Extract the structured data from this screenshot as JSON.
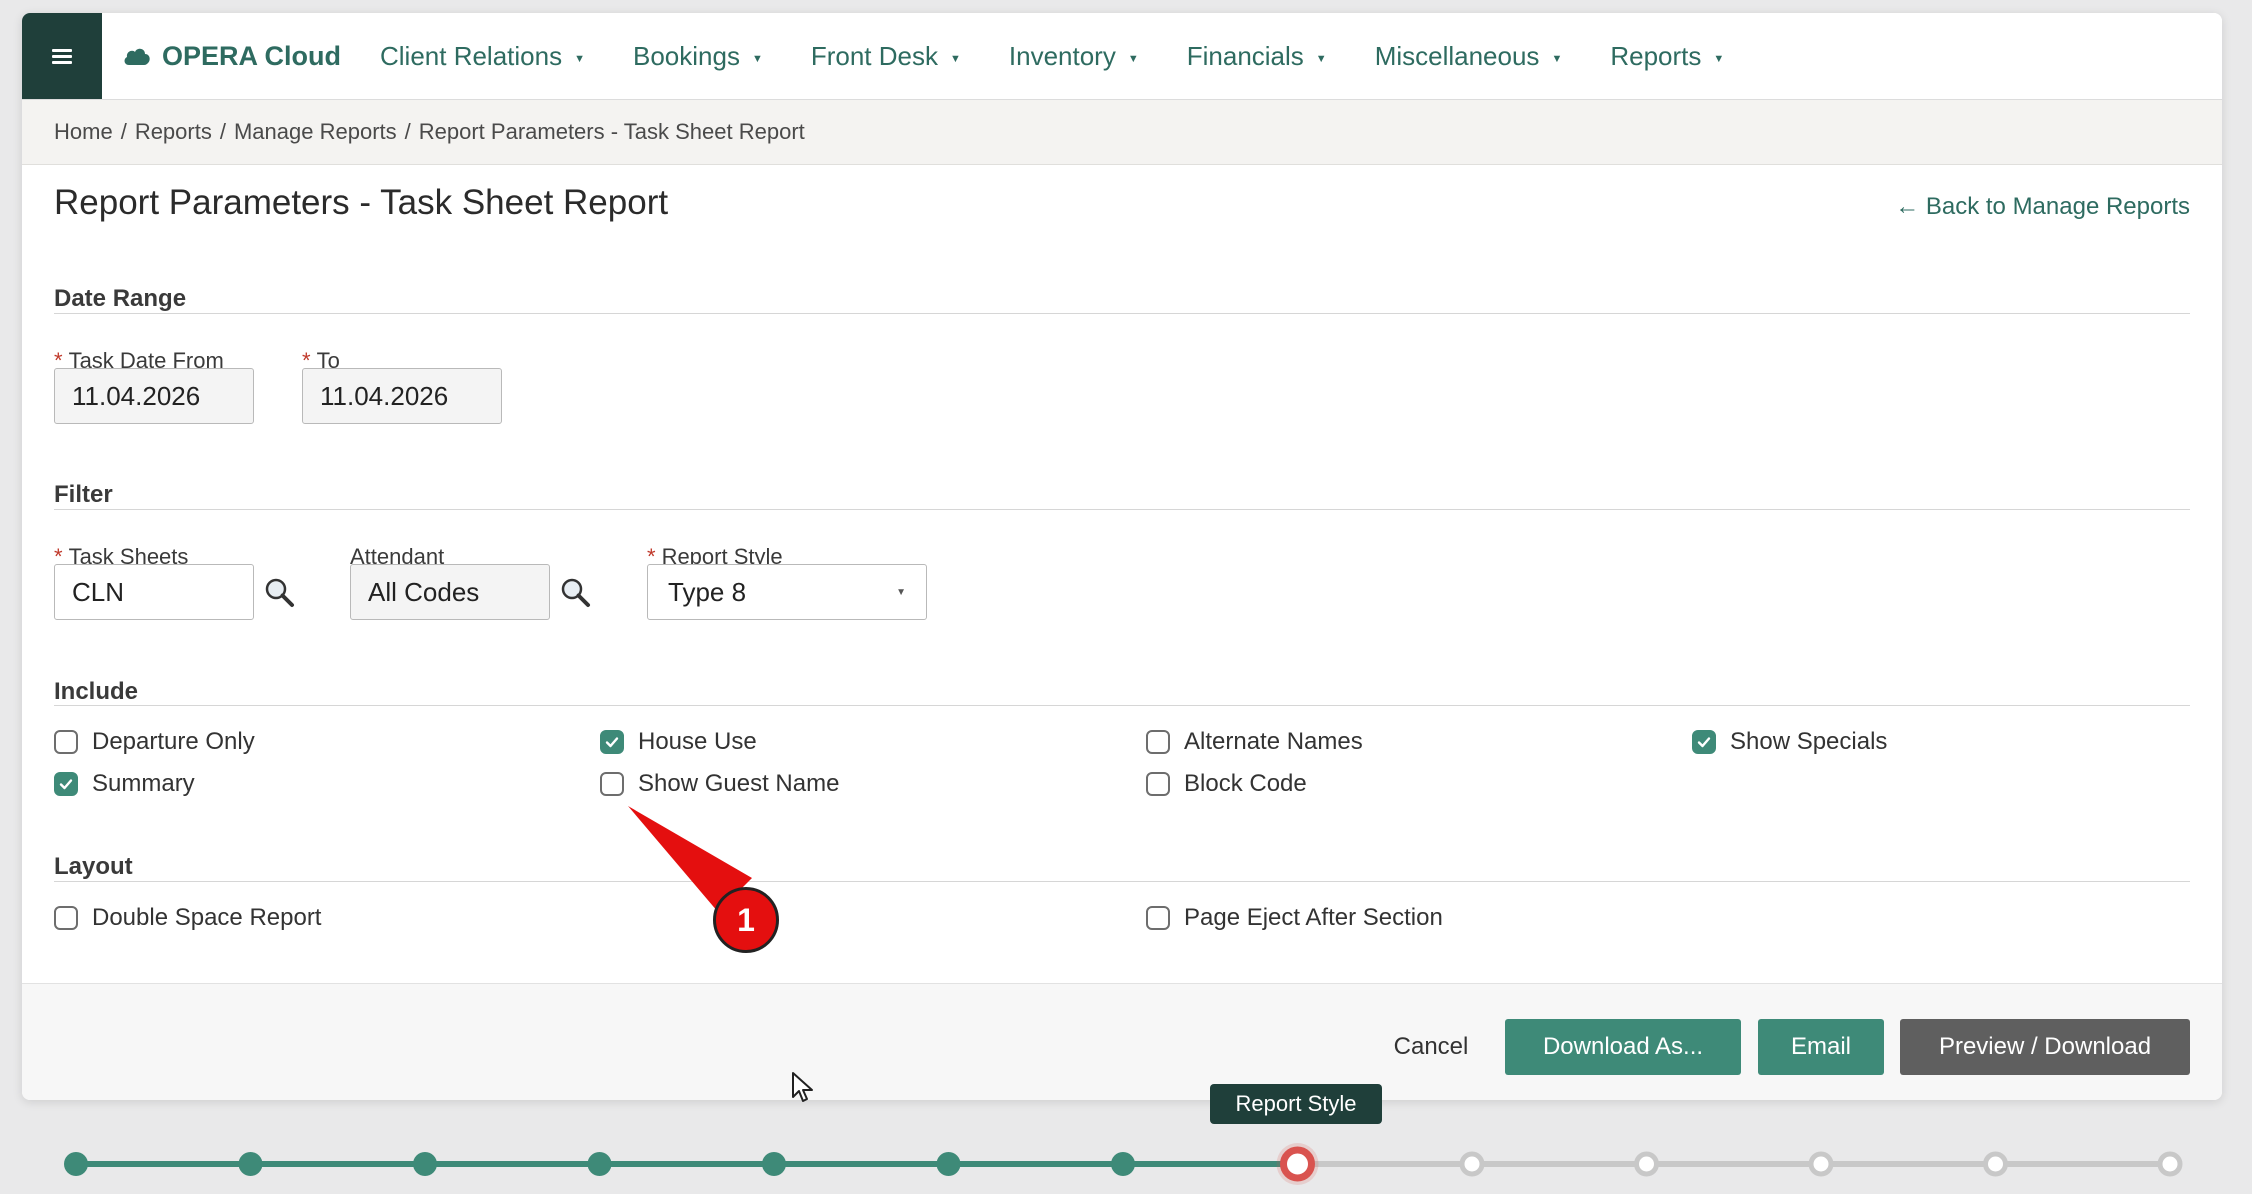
{
  "app": {
    "logo_text": "OPERA Cloud"
  },
  "nav": [
    {
      "label": "Client Relations"
    },
    {
      "label": "Bookings"
    },
    {
      "label": "Front Desk"
    },
    {
      "label": "Inventory"
    },
    {
      "label": "Financials"
    },
    {
      "label": "Miscellaneous"
    },
    {
      "label": "Reports"
    }
  ],
  "breadcrumb": [
    "Home",
    "Reports",
    "Manage Reports",
    "Report Parameters - Task Sheet Report"
  ],
  "page": {
    "title": "Report Parameters - Task Sheet Report",
    "back_link": "← Back to Manage Reports"
  },
  "date_range": {
    "section": "Date Range",
    "from_label": "Task Date From",
    "from_value": "11.04.2026",
    "to_label": "To",
    "to_value": "11.04.2026"
  },
  "filter": {
    "section": "Filter",
    "task_sheets_label": "Task Sheets",
    "task_sheets_value": "CLN",
    "attendant_label": "Attendant",
    "attendant_value": "All Codes",
    "report_style_label": "Report Style",
    "report_style_value": "Type 8"
  },
  "include": {
    "section": "Include",
    "items": [
      {
        "label": "Departure Only",
        "checked": false
      },
      {
        "label": "House Use",
        "checked": true
      },
      {
        "label": "Alternate Names",
        "checked": false
      },
      {
        "label": "Show Specials",
        "checked": true
      },
      {
        "label": "Summary",
        "checked": true
      },
      {
        "label": "Show Guest Name",
        "checked": false
      },
      {
        "label": "Block Code",
        "checked": false
      }
    ]
  },
  "layout": {
    "section": "Layout",
    "items": [
      {
        "label": "Double Space Report",
        "checked": false
      },
      {
        "label": "Page Eject After Section",
        "checked": false
      }
    ]
  },
  "footer": {
    "cancel": "Cancel",
    "download_as": "Download As...",
    "email": "Email",
    "preview": "Preview / Download"
  },
  "annotation": {
    "number": "1"
  },
  "progress": {
    "tooltip": "Report Style",
    "total_steps": 13,
    "completed_steps": 7,
    "current_step": 8
  },
  "colors": {
    "brand_dark": "#1f3f3a",
    "brand_green": "#3e8a78",
    "link_green": "#2e6b60",
    "current_step": "#d9534f",
    "pending_step": "#c8c8c8",
    "callout_red": "#e40f0f"
  }
}
